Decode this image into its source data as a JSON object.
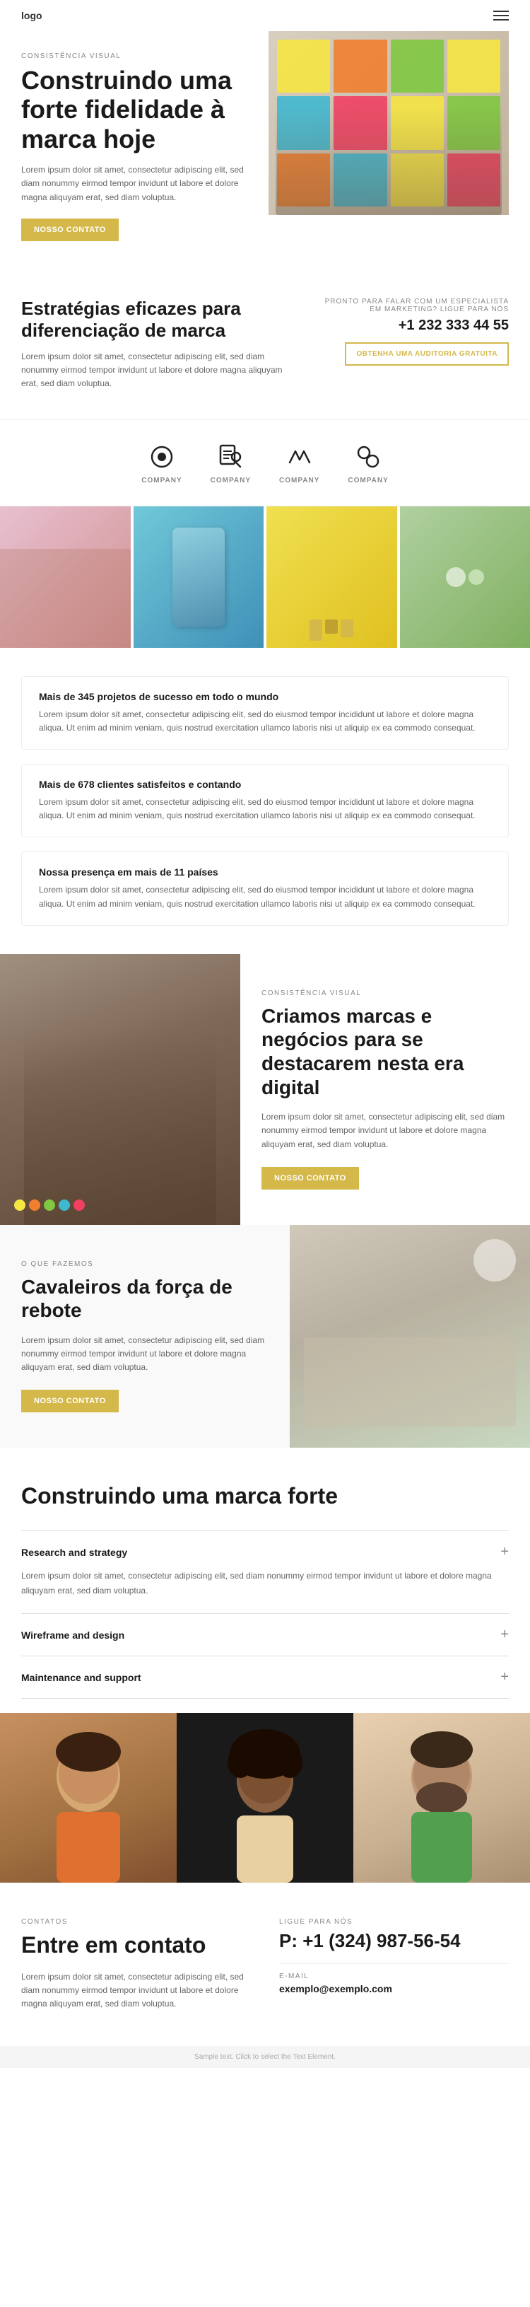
{
  "nav": {
    "logo": "logo",
    "hamburger_label": "menu"
  },
  "hero": {
    "label": "CONSISTÊNCIA VISUAL",
    "title": "Construindo uma forte fidelidade à marca hoje",
    "body": "Lorem ipsum dolor sit amet, consectetur adipiscing elit, sed diam nonummy eirmod tempor invidunt ut labore et dolore magna aliquyam erat, sed diam voluptua.",
    "button": "NOSSO CONTATO"
  },
  "strategy": {
    "title": "Estratégias eficazes para diferenciação de marca",
    "body": "Lorem ipsum dolor sit amet, consectetur adipiscing elit, sed diam nonummy eirmod tempor invidunt ut labore et dolore magna aliquyam erat, sed diam voluptua.",
    "cta_label": "PRONTO PARA FALAR COM UM ESPECIALISTA EM MARKETING? LIGUE PARA NÓS",
    "phone": "+1 232 333 44 55",
    "audit_button": "OBTENHA UMA AUDITORIA GRATUITA"
  },
  "logos": [
    {
      "id": "logo1",
      "name": "COMPANY",
      "icon": "circle"
    },
    {
      "id": "logo2",
      "name": "COMPANY",
      "icon": "book"
    },
    {
      "id": "logo3",
      "name": "COMPANY",
      "icon": "w"
    },
    {
      "id": "logo4",
      "name": "COMPANY",
      "icon": "circles"
    }
  ],
  "stats": [
    {
      "title": "Mais de 345 projetos de sucesso em todo o mundo",
      "body": "Lorem ipsum dolor sit amet, consectetur adipiscing elit, sed do eiusmod tempor incididunt ut labore et dolore magna aliqua. Ut enim ad minim veniam, quis nostrud exercitation ullamco laboris nisi ut aliquip ex ea commodo consequat."
    },
    {
      "title": "Mais de 678 clientes satisfeitos e contando",
      "body": "Lorem ipsum dolor sit amet, consectetur adipiscing elit, sed do eiusmod tempor incididunt ut labore et dolore magna aliqua. Ut enim ad minim veniam, quis nostrud exercitation ullamco laboris nisi ut aliquip ex ea commodo consequat."
    },
    {
      "title": "Nossa presença em mais de 11 países",
      "body": "Lorem ipsum dolor sit amet, consectetur adipiscing elit, sed do eiusmod tempor incididunt ut labore et dolore magna aliqua. Ut enim ad minim veniam, quis nostrud exercitation ullamco laboris nisi ut aliquip ex ea commodo consequat."
    }
  ],
  "digital": {
    "label": "CONSISTÊNCIA VISUAL",
    "title": "Criamos marcas e negócios para se destacarem nesta era digital",
    "body": "Lorem ipsum dolor sit amet, consectetur adipiscing elit, sed diam nonummy eirmod tempor invidunt ut labore et dolore magna aliquyam erat, sed diam voluptua.",
    "button": "NOSSO CONTATO"
  },
  "whatwedo": {
    "label": "O QUE FAZEMOS",
    "title": "Cavaleiros da força de rebote",
    "body": "Lorem ipsum dolor sit amet, consectetur adipiscing elit, sed diam nonummy eirmod tempor invidunt ut labore et dolore magna aliquyam erat, sed diam voluptua.",
    "button": "NOSSO CONTATO"
  },
  "brand": {
    "title": "Construindo uma marca forte",
    "accordion": [
      {
        "id": "acc1",
        "header": "Research and strategy",
        "open": true,
        "body": "Lorem ipsum dolor sit amet, consectetur adipiscing elit, sed diam nonummy eirmod tempor invidunt ut labore et dolore magna aliquyam erat, sed diam voluptua."
      },
      {
        "id": "acc2",
        "header": "Wireframe and design",
        "open": false,
        "body": ""
      },
      {
        "id": "acc3",
        "header": "Maintenance and support",
        "open": false,
        "body": ""
      }
    ]
  },
  "contact": {
    "left_label": "CONTATOS",
    "left_title": "Entre em contato",
    "left_body": "Lorem ipsum dolor sit amet, consectetur adipiscing elit, sed diam nonummy eirmod tempor invidunt ut labore et dolore magna aliquyam erat, sed diam voluptua.",
    "right_label": "LIGUE PARA NÓS",
    "phone_prefix": "P:",
    "phone": "+1 (324) 987-56-54",
    "email_label": "E-MAIL",
    "email": "exemplo@exemplo.com"
  },
  "footer": {
    "sample_text": "Sample text. Click to select the Text Element."
  }
}
